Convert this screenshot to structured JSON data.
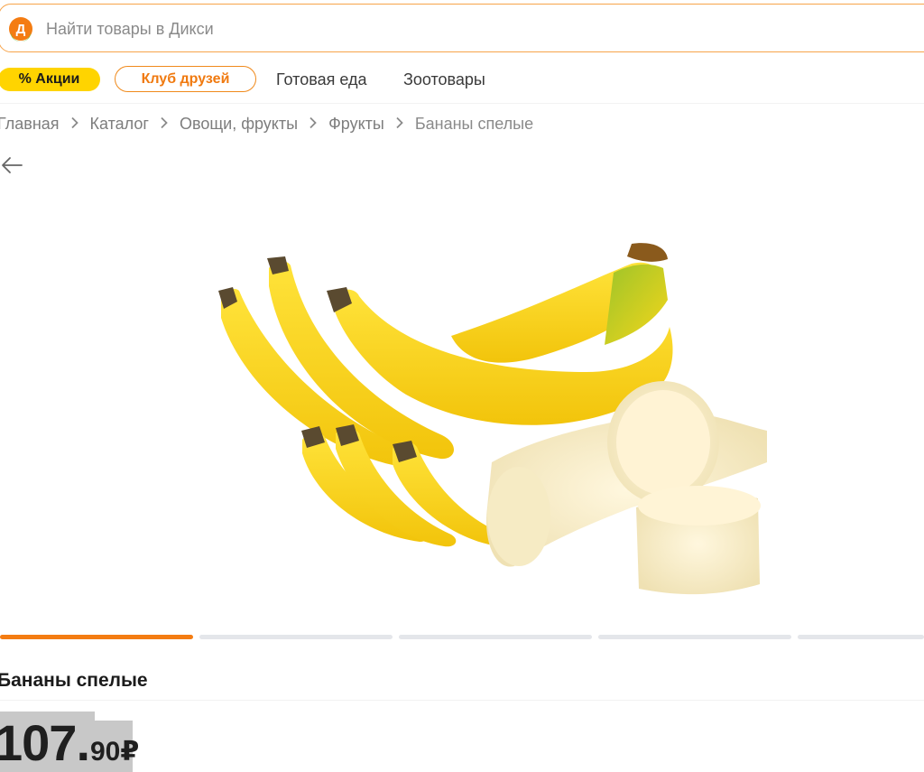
{
  "search": {
    "placeholder": "Найти товары в Дикси",
    "logo_letter": "Д"
  },
  "nav": {
    "promo_label": "% Акции",
    "club_label": "Клуб друзей",
    "ready_food_label": "Готовая еда",
    "pet_goods_label": "Зоотовары"
  },
  "breadcrumb": {
    "items": [
      "Главная",
      "Каталог",
      "Овощи, фрукты",
      "Фрукты"
    ],
    "current": "Бананы спелые",
    "separator": "›"
  },
  "gallery": {
    "active_index": 0,
    "count": 5
  },
  "product": {
    "title": "Бананы спелые",
    "price_integer": "107",
    "price_dot": ".",
    "price_fraction": "90",
    "currency": "₽"
  },
  "colors": {
    "accent_orange": "#f07a10",
    "promo_yellow": "#ffd400",
    "indicator_active": "#f47c12",
    "indicator_inactive": "#e4e6ea"
  }
}
